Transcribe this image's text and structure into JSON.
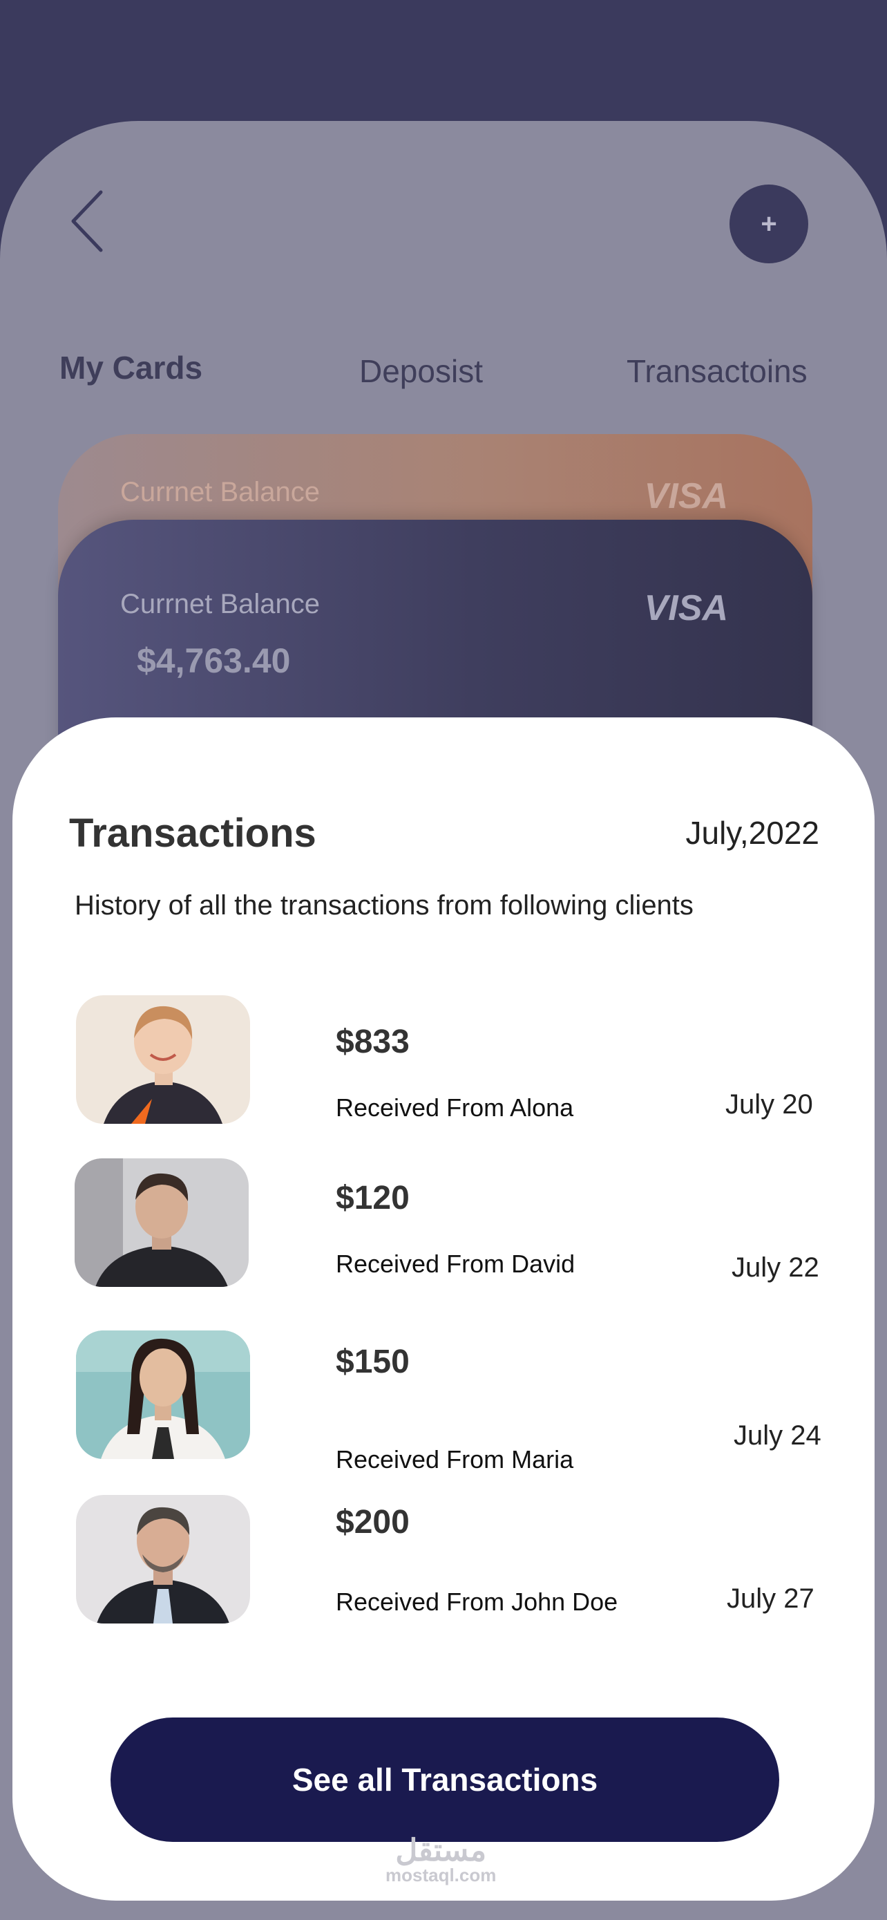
{
  "header": {
    "back_icon": "chevron-left-icon",
    "add_label": "+"
  },
  "tabs": [
    {
      "label": "My Cards",
      "active": true
    },
    {
      "label": "Deposist",
      "active": false
    },
    {
      "label": "Transactoins",
      "active": false
    }
  ],
  "cards": {
    "back": {
      "label": "Currnet Balance",
      "brand": "VISA"
    },
    "front": {
      "label": "Currnet Balance",
      "brand": "VISA",
      "amount": "$4,763.40"
    }
  },
  "transactions": {
    "title": "Transactions",
    "month": "July,2022",
    "subtitle": "History of all the transactions from following clients",
    "items": [
      {
        "amount": "$833",
        "desc": "Received From Alona",
        "date": "July 20"
      },
      {
        "amount": "$120",
        "desc": "Received From David",
        "date": "July 22"
      },
      {
        "amount": "$150",
        "desc": "Received From Maria",
        "date": "July 24"
      },
      {
        "amount": "$200",
        "desc": "Received From John Doe",
        "date": "July 27"
      }
    ],
    "see_all_label": "See all Transactions"
  },
  "watermark": {
    "arabic": "مستقل",
    "latin": "mostaql.com"
  },
  "colors": {
    "background": "#3b3a5d",
    "panel": "#8b8a9e",
    "button": "#1a1a4f",
    "card_back": "#a8735f",
    "card_front": "#3f3e5e"
  }
}
